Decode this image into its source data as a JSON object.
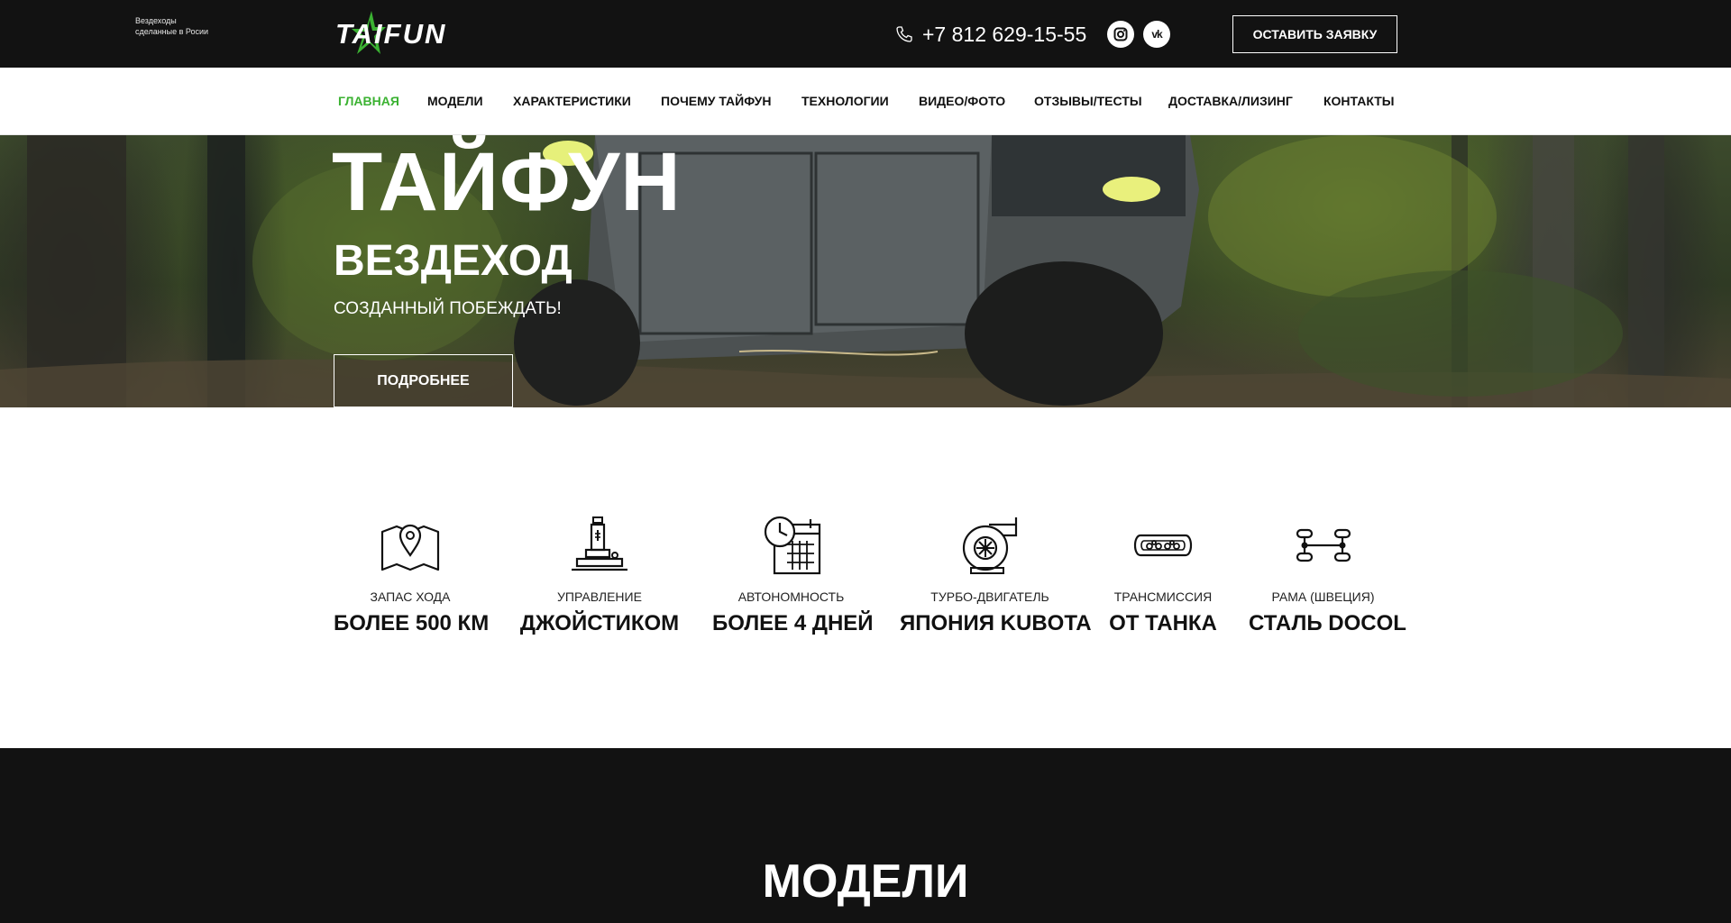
{
  "header": {
    "logo_text": "TAIFUN",
    "tagline_line1": "Вездеходы",
    "tagline_line2": "сделанные в Росии",
    "phone": "+7 812 629-15-55",
    "social_icons": [
      "instagram-icon",
      "vk-icon"
    ],
    "vk_glyph": "vk",
    "cta_label": "ОСТАВИТЬ ЗАЯВКУ",
    "brand_color": "#3bb232",
    "bar_color": "#121212"
  },
  "nav": {
    "items": [
      {
        "label": "ГЛАВНАЯ",
        "active": true
      },
      {
        "label": "МОДЕЛИ"
      },
      {
        "label": "ХАРАКТЕРИСТИКИ"
      },
      {
        "label": "ПОЧЕМУ ТАЙФУН"
      },
      {
        "label": "ТЕХНОЛОГИИ"
      },
      {
        "label": "ВИДЕО/ФОТО"
      },
      {
        "label": "ОТЗЫВЫ/ТЕСТЫ"
      },
      {
        "label": "ДОСТАВКА/ЛИЗИНГ"
      },
      {
        "label": "КОНТАКТЫ"
      }
    ]
  },
  "hero": {
    "title": "ТАЙФУН",
    "subtitle": "ВЕЗДЕХОД",
    "tagline": "СОЗДАННЫЙ ПОБЕЖДАТЬ!",
    "button_label": "ПОДРОБНЕЕ"
  },
  "features": [
    {
      "icon": "map-pin-icon",
      "label": "ЗАПАС ХОДА",
      "value": "БОЛЕЕ 500 КМ"
    },
    {
      "icon": "joystick-icon",
      "label": "УПРАВЛЕНИЕ",
      "value": "ДЖОЙСТИКОМ"
    },
    {
      "icon": "calendar-clock-icon",
      "label": "АВТОНОМНОСТЬ",
      "value": "БОЛЕЕ 4 ДНЕЙ"
    },
    {
      "icon": "turbo-engine-icon",
      "label": "ТУРБО-ДВИГАТЕЛЬ",
      "value": "ЯПОНИЯ KUBOTA"
    },
    {
      "icon": "tank-track-icon",
      "label": "ТРАНСМИССИЯ",
      "value": "ОТ ТАНКА"
    },
    {
      "icon": "frame-chassis-icon",
      "label": "РАМА (ШВЕЦИЯ)",
      "value": "СТАЛЬ DOCOL"
    }
  ],
  "models": {
    "title": "МОДЕЛИ"
  }
}
